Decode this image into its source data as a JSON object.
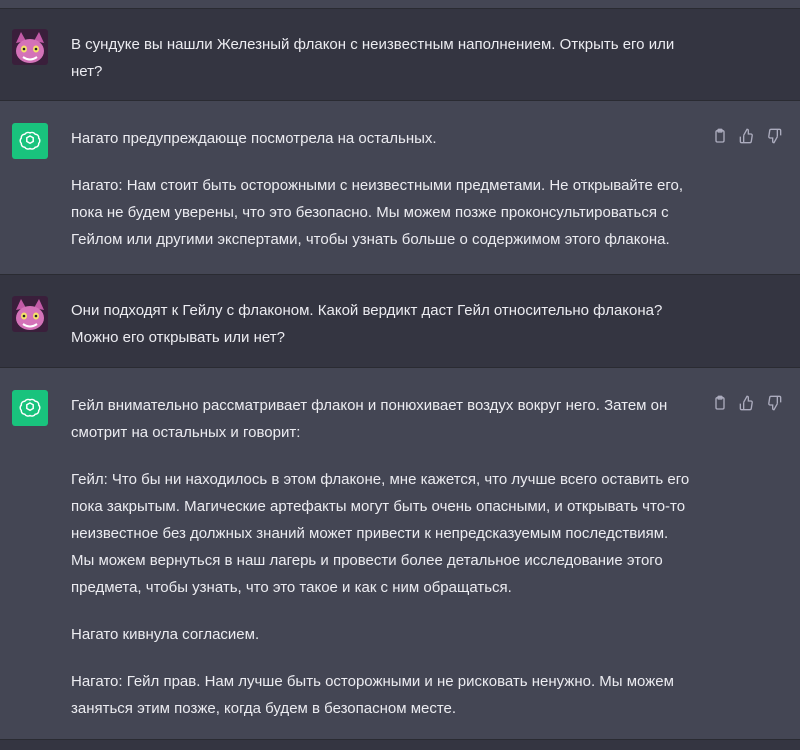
{
  "colors": {
    "user_bg": "#343541",
    "assistant_bg": "#444654",
    "gpt_icon_bg": "#19c37d",
    "text": "#ececf1",
    "icon": "#acacbe"
  },
  "icons": {
    "user_avatar": "pink-cat-avatar",
    "assistant_avatar": "openai-logo-icon",
    "copy": "clipboard-icon",
    "like": "thumbs-up-icon",
    "dislike": "thumbs-down-icon"
  },
  "messages": [
    {
      "role": "user",
      "lines": [
        "В сундуке вы нашли Железный флакон с неизвестным наполнением. Открыть его или",
        "нет?"
      ]
    },
    {
      "role": "assistant",
      "paragraphs": [
        [
          "Нагато предупреждающе посмотрела на остальных."
        ],
        [
          "Нагато: Нам стоит быть осторожными с неизвестными предметами. Не открывайте его,",
          "пока не будем уверены, что это безопасно. Мы можем позже проконсультироваться с",
          "Гейлом или другими экспертами, чтобы узнать больше о содержимом этого флакона."
        ]
      ]
    },
    {
      "role": "user",
      "lines": [
        "Они подходят к Гейлу с флаконом. Какой вердикт даст Гейл относительно флакона?",
        "Можно его открывать или нет?"
      ]
    },
    {
      "role": "assistant",
      "paragraphs": [
        [
          "Гейл внимательно рассматривает флакон и понюхивает воздух вокруг него. Затем он",
          "смотрит на остальных и говорит:"
        ],
        [
          "Гейл: Что бы ни находилось в этом флаконе, мне кажется, что лучше всего оставить его",
          "пока закрытым. Магические артефакты могут быть очень опасными, и открывать что-то",
          "неизвестное без должных знаний может привести к непредсказуемым последствиям.",
          "Мы можем вернуться в наш лагерь и провести более детальное исследование этого",
          "предмета, чтобы узнать, что это такое и как с ним обращаться."
        ],
        [
          "Нагато кивнула согласием."
        ],
        [
          "Нагато: Гейл прав. Нам лучше быть осторожными и не рисковать ненужно. Мы можем",
          "заняться этим позже, когда будем в безопасном месте."
        ]
      ]
    }
  ]
}
